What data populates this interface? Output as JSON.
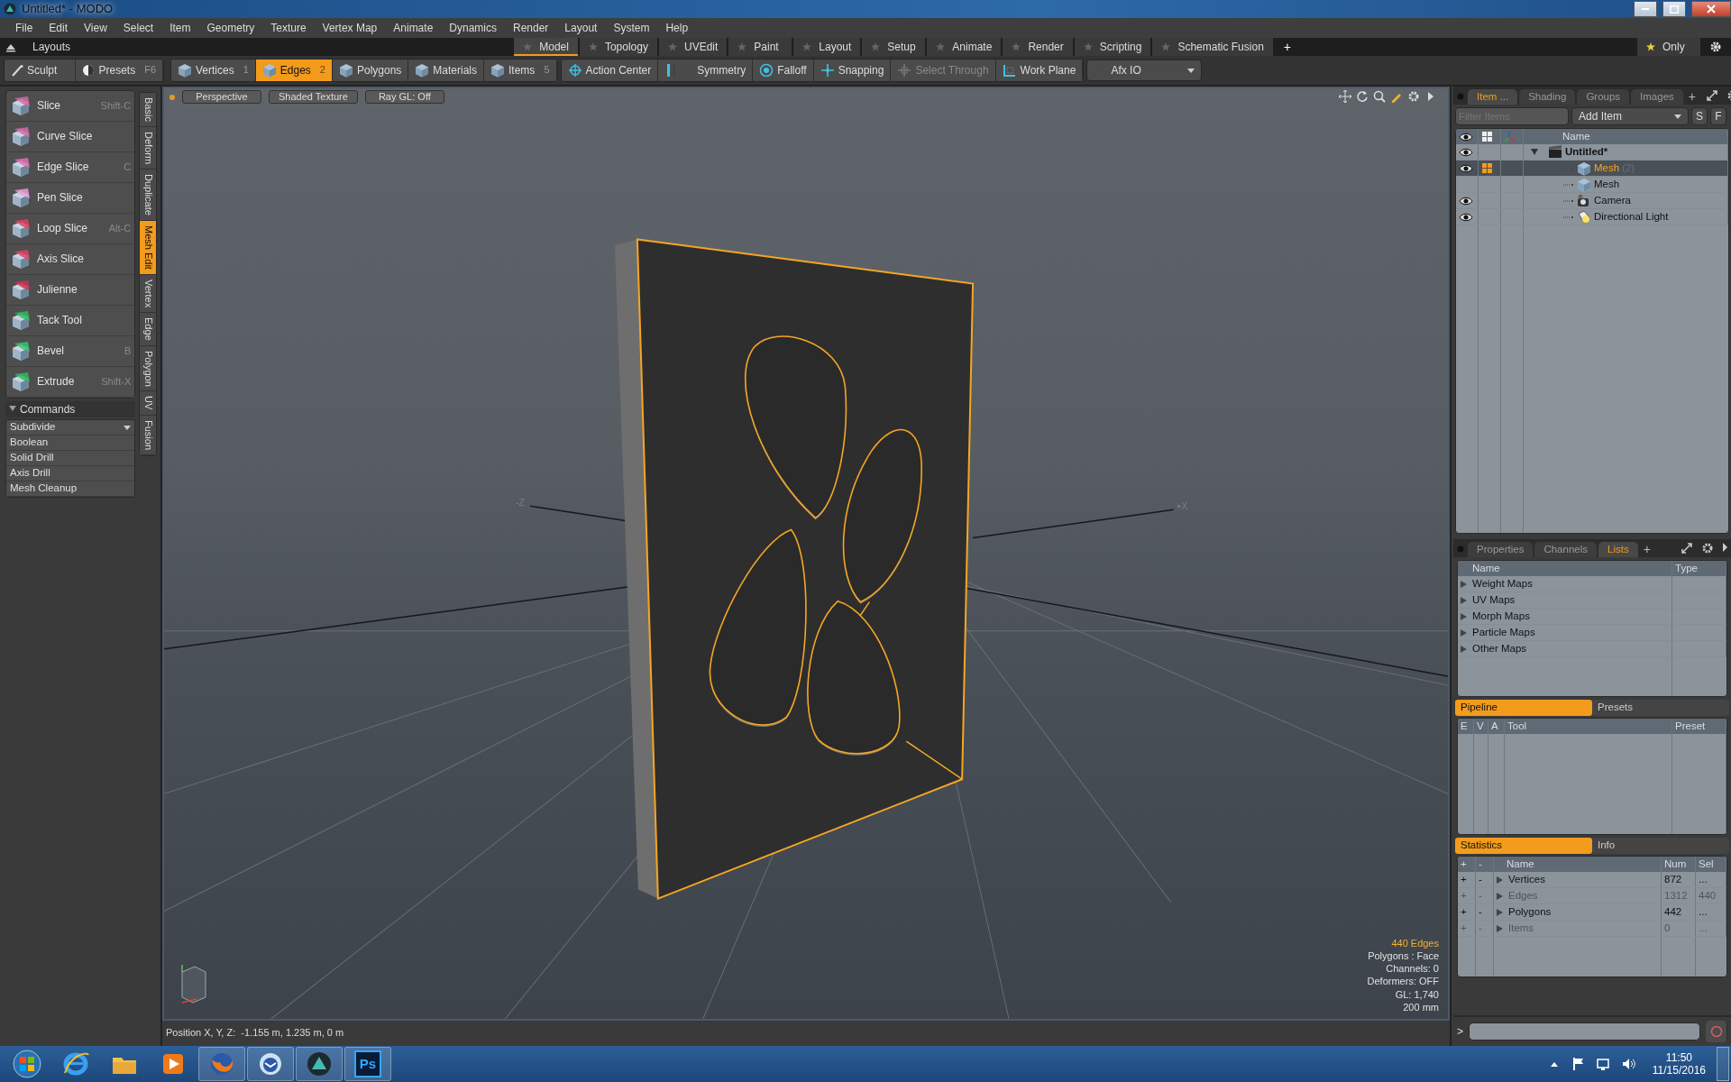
{
  "window": {
    "title": "Untitled* - MODO"
  },
  "menu": [
    "File",
    "Edit",
    "View",
    "Select",
    "Item",
    "Geometry",
    "Texture",
    "Vertex Map",
    "Animate",
    "Dynamics",
    "Render",
    "Layout",
    "System",
    "Help"
  ],
  "layouts": {
    "label": "Layouts",
    "tabs": [
      {
        "label": "Model",
        "selected": true
      },
      {
        "label": "Topology",
        "selected": false
      },
      {
        "label": "UVEdit",
        "selected": false
      },
      {
        "label": "Paint",
        "selected": false
      },
      {
        "label": "Layout",
        "selected": false
      },
      {
        "label": "Setup",
        "selected": false
      },
      {
        "label": "Animate",
        "selected": false
      },
      {
        "label": "Render",
        "selected": false
      },
      {
        "label": "Scripting",
        "selected": false
      },
      {
        "label": "Schematic Fusion",
        "selected": false
      }
    ],
    "add": "+",
    "only": "Only"
  },
  "toolbar": {
    "sculpt": "Sculpt",
    "presets": {
      "label": "Presets",
      "shortcut": "F6"
    },
    "modes": [
      {
        "label": "Vertices",
        "shortcut": "1",
        "selected": false
      },
      {
        "label": "Edges",
        "shortcut": "2",
        "selected": true
      },
      {
        "label": "Polygons",
        "selected": false
      },
      {
        "label": "Materials",
        "selected": false
      },
      {
        "label": "Items",
        "shortcut": "5",
        "selected": false
      }
    ],
    "tools": [
      {
        "label": "Action Center",
        "kind": "center",
        "disabled": false
      },
      {
        "label": "Symmetry",
        "kind": "symmetry",
        "disabled": false
      },
      {
        "label": "Falloff",
        "kind": "falloff",
        "disabled": false
      },
      {
        "label": "Snapping",
        "kind": "snap",
        "disabled": false
      },
      {
        "label": "Select Through",
        "kind": "through",
        "disabled": true
      },
      {
        "label": "Work Plane",
        "kind": "plane",
        "disabled": false
      }
    ],
    "dropdown": "Afx IO"
  },
  "tool_panel": {
    "tools": [
      {
        "label": "Slice",
        "shortcut": "Shift-C"
      },
      {
        "label": "Curve Slice"
      },
      {
        "label": "Edge Slice",
        "shortcut": "C"
      },
      {
        "label": "Pen Slice"
      },
      {
        "label": "Loop Slice",
        "shortcut": "Alt-C"
      },
      {
        "label": "Axis Slice"
      },
      {
        "label": "Julienne"
      },
      {
        "label": "Tack Tool"
      },
      {
        "label": "Bevel",
        "shortcut": "B"
      },
      {
        "label": "Extrude",
        "shortcut": "Shift-X"
      }
    ],
    "side_tabs": [
      {
        "label": "Basic",
        "selected": false
      },
      {
        "label": "Deform",
        "selected": false
      },
      {
        "label": "Duplicate",
        "selected": false
      },
      {
        "label": "Mesh Edit",
        "selected": true
      },
      {
        "label": "Vertex",
        "selected": false
      },
      {
        "label": "Edge",
        "selected": false
      },
      {
        "label": "Polygon",
        "selected": false
      },
      {
        "label": "UV",
        "selected": false
      },
      {
        "label": "Fusion",
        "selected": false
      }
    ],
    "commands": {
      "title": "Commands",
      "expanded": true,
      "dropdown": "Subdivide",
      "items": [
        "Boolean",
        "Solid Drill",
        "Axis Drill",
        "Mesh Cleanup"
      ]
    }
  },
  "viewport": {
    "view_buttons": [
      "Perspective",
      "Shaded Texture",
      "Ray GL: Off"
    ],
    "axis_labels": [
      "-Z",
      "+X"
    ],
    "info": [
      {
        "text": "440 Edges",
        "highlight": true
      },
      {
        "text": "Polygons : Face",
        "highlight": false
      },
      {
        "text": "Channels: 0",
        "highlight": false
      },
      {
        "text": "Deformers: OFF",
        "highlight": false
      },
      {
        "text": "GL: 1,740",
        "highlight": false
      },
      {
        "text": "200 mm",
        "highlight": false
      }
    ],
    "status": "Position X, Y, Z:  -1.155 m, 1.235 m, 0 m"
  },
  "item_panel": {
    "tabs": [
      {
        "label": "Item ...",
        "selected": true
      },
      {
        "label": "Shading",
        "selected": false
      },
      {
        "label": "Groups",
        "selected": false
      },
      {
        "label": "Images",
        "selected": false
      }
    ],
    "add": "+",
    "filter": {
      "placeholder": "Filter Items"
    },
    "add_item": "Add Item",
    "buttons": [
      "S",
      "F"
    ],
    "column": "Name",
    "tree": [
      {
        "name": "Untitled*",
        "kind": "scene",
        "visible": true,
        "selected": false,
        "expanded": true,
        "children": [
          {
            "name": "Mesh",
            "count": "(2)",
            "kind": "mesh",
            "visible": true,
            "selected": true
          },
          {
            "name": "Mesh",
            "kind": "mesh",
            "visible": false,
            "selected": false
          },
          {
            "name": "Camera",
            "kind": "camera",
            "visible": true,
            "selected": false
          },
          {
            "name": "Directional Light",
            "kind": "light",
            "visible": true,
            "selected": false
          }
        ]
      }
    ]
  },
  "lists_panel": {
    "tabs": [
      {
        "label": "Properties",
        "selected": false
      },
      {
        "label": "Channels",
        "selected": false
      },
      {
        "label": "Lists",
        "selected": true
      }
    ],
    "add": "+",
    "columns": [
      "Name",
      "Type"
    ],
    "rows": [
      "Weight Maps",
      "UV Maps",
      "Morph Maps",
      "Particle Maps",
      "Other Maps"
    ]
  },
  "pipeline": {
    "tabs": [
      {
        "label": "Pipeline",
        "selected": true
      },
      {
        "label": "Presets",
        "selected": false
      }
    ],
    "columns": [
      "E",
      "V",
      "A",
      "Tool",
      "Preset"
    ]
  },
  "statistics": {
    "tabs": [
      {
        "label": "Statistics",
        "selected": true
      },
      {
        "label": "Info",
        "selected": false
      }
    ],
    "columns": [
      "+",
      "-",
      "Name",
      "Num",
      "Sel"
    ],
    "rows": [
      {
        "add": "+",
        "remove": "-",
        "name": "Vertices",
        "num": "872",
        "sel": "...",
        "disabled": false
      },
      {
        "add": "+",
        "remove": "-",
        "name": "Edges",
        "num": "1312",
        "sel": "440",
        "disabled": true
      },
      {
        "add": "+",
        "remove": "-",
        "name": "Polygons",
        "num": "442",
        "sel": "...",
        "disabled": false
      },
      {
        "add": "+",
        "remove": "-",
        "name": "Items",
        "num": "0",
        "sel": "...",
        "disabled": true
      }
    ]
  },
  "command_line": {
    "prompt": ">"
  },
  "taskbar": {
    "apps": [
      {
        "kind": "explorer",
        "open": false
      },
      {
        "kind": "folder",
        "open": false
      },
      {
        "kind": "media",
        "open": false
      },
      {
        "kind": "browser",
        "open": true
      },
      {
        "kind": "mail",
        "open": true
      },
      {
        "kind": "modo",
        "open": true
      },
      {
        "kind": "photoshop",
        "label": "Ps",
        "open": true
      }
    ],
    "clock": "11:50",
    "date": "11/15/2016"
  }
}
